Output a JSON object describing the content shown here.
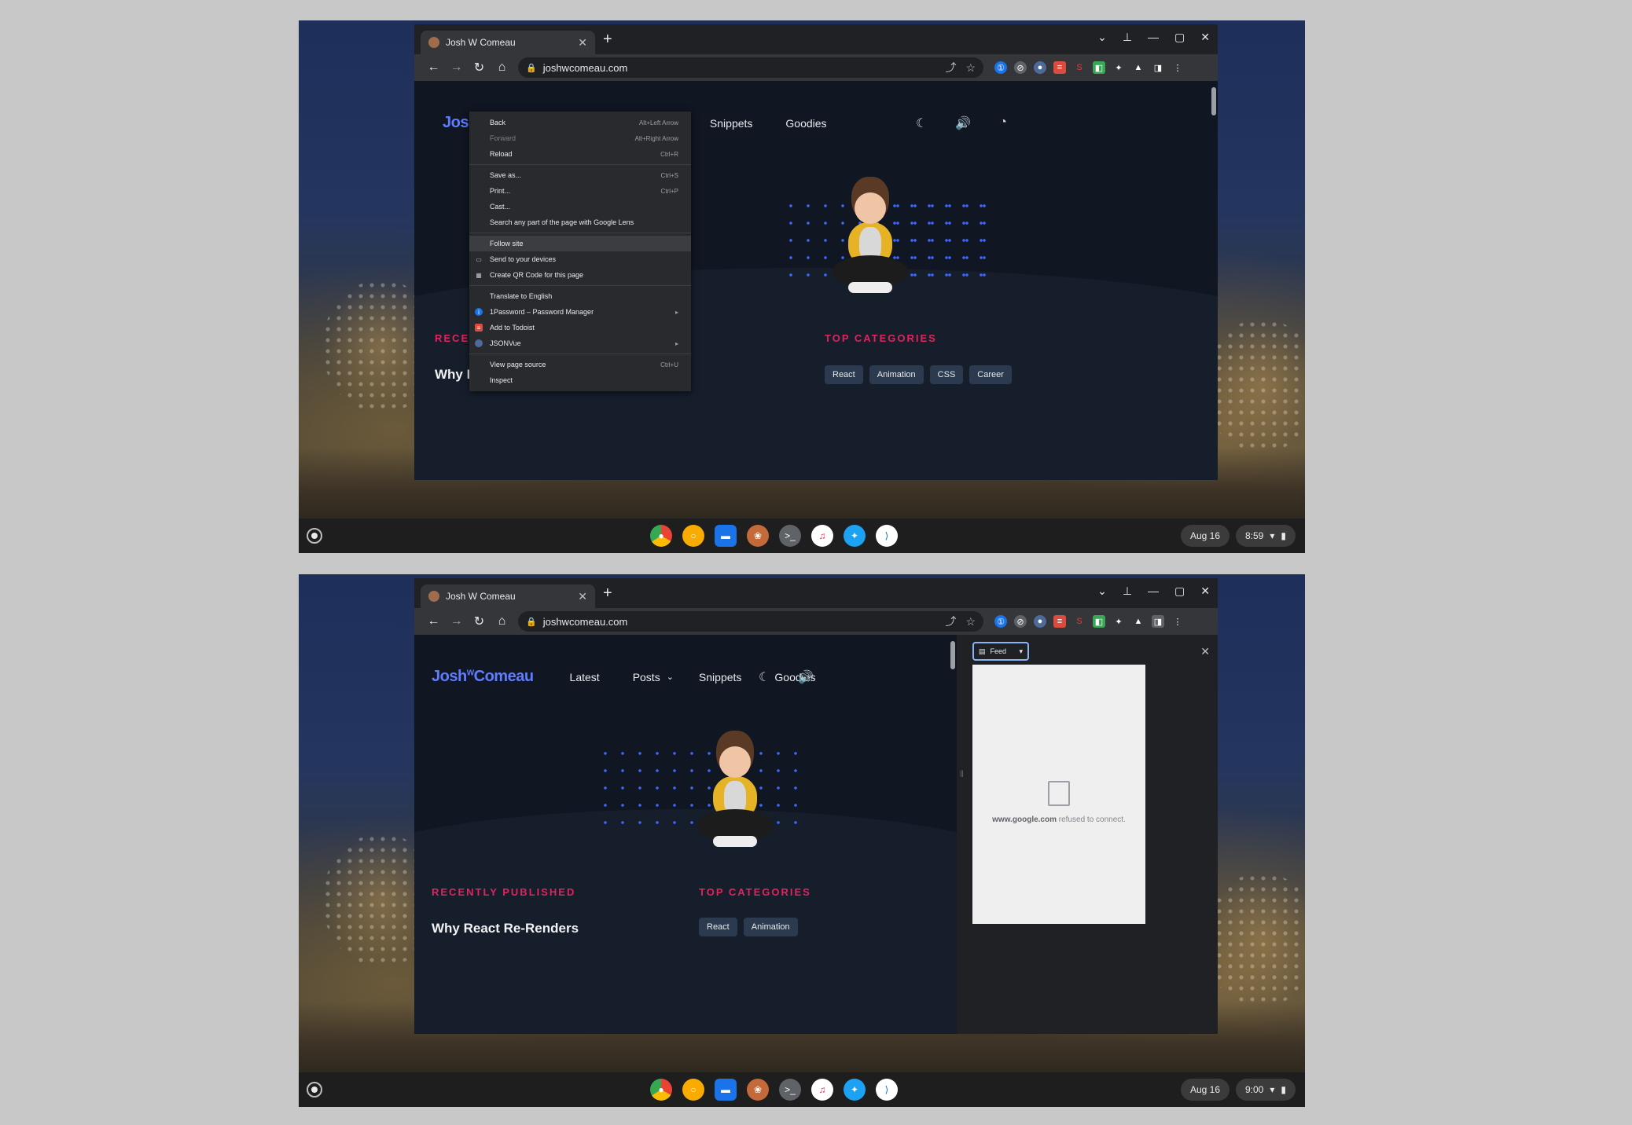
{
  "browser": {
    "tab_title": "Josh W Comeau",
    "url": "joshwcomeau.com"
  },
  "site": {
    "logo_first": "Josh",
    "logo_w": "W",
    "logo_last": "Comeau",
    "nav": [
      "Latest",
      "Posts",
      "Snippets",
      "Goodies"
    ],
    "recently_published": "RECENTLY PUBLISHED",
    "recently_published_clipped": "RECENT",
    "top_categories": "TOP CATEGORIES",
    "post_title": "Why React Re-Renders",
    "post_title_clipped": "Why R",
    "categories": [
      "React",
      "Animation",
      "CSS",
      "Career"
    ]
  },
  "context_menu": {
    "items": [
      {
        "label": "Back",
        "shortcut": "Alt+Left Arrow"
      },
      {
        "label": "Forward",
        "shortcut": "Alt+Right Arrow"
      },
      {
        "label": "Reload",
        "shortcut": "Ctrl+R"
      },
      {
        "label": "Save as...",
        "shortcut": "Ctrl+S"
      },
      {
        "label": "Print...",
        "shortcut": "Ctrl+P"
      },
      {
        "label": "Cast...",
        "shortcut": ""
      },
      {
        "label": "Search any part of the page with Google Lens",
        "shortcut": ""
      },
      {
        "label": "Follow site",
        "shortcut": ""
      },
      {
        "label": "Send to your devices",
        "shortcut": ""
      },
      {
        "label": "Create QR Code for this page",
        "shortcut": ""
      },
      {
        "label": "Translate to English",
        "shortcut": ""
      },
      {
        "label": "1Password – Password Manager",
        "shortcut": ""
      },
      {
        "label": "Add to Todoist",
        "shortcut": ""
      },
      {
        "label": "JSONVue",
        "shortcut": ""
      },
      {
        "label": "View page source",
        "shortcut": "Ctrl+U"
      },
      {
        "label": "Inspect",
        "shortcut": ""
      }
    ]
  },
  "side_panel": {
    "selected": "Feed",
    "error_host": "www.google.com",
    "error_msg": "refused to connect."
  },
  "shelf": {
    "date": "Aug 16",
    "time_top": "8:59",
    "time_bottom": "9:00"
  },
  "colors": {
    "accent_blue": "#5f7dff",
    "section_pink": "#e0245e",
    "focus_ring": "#8ab4f8"
  }
}
